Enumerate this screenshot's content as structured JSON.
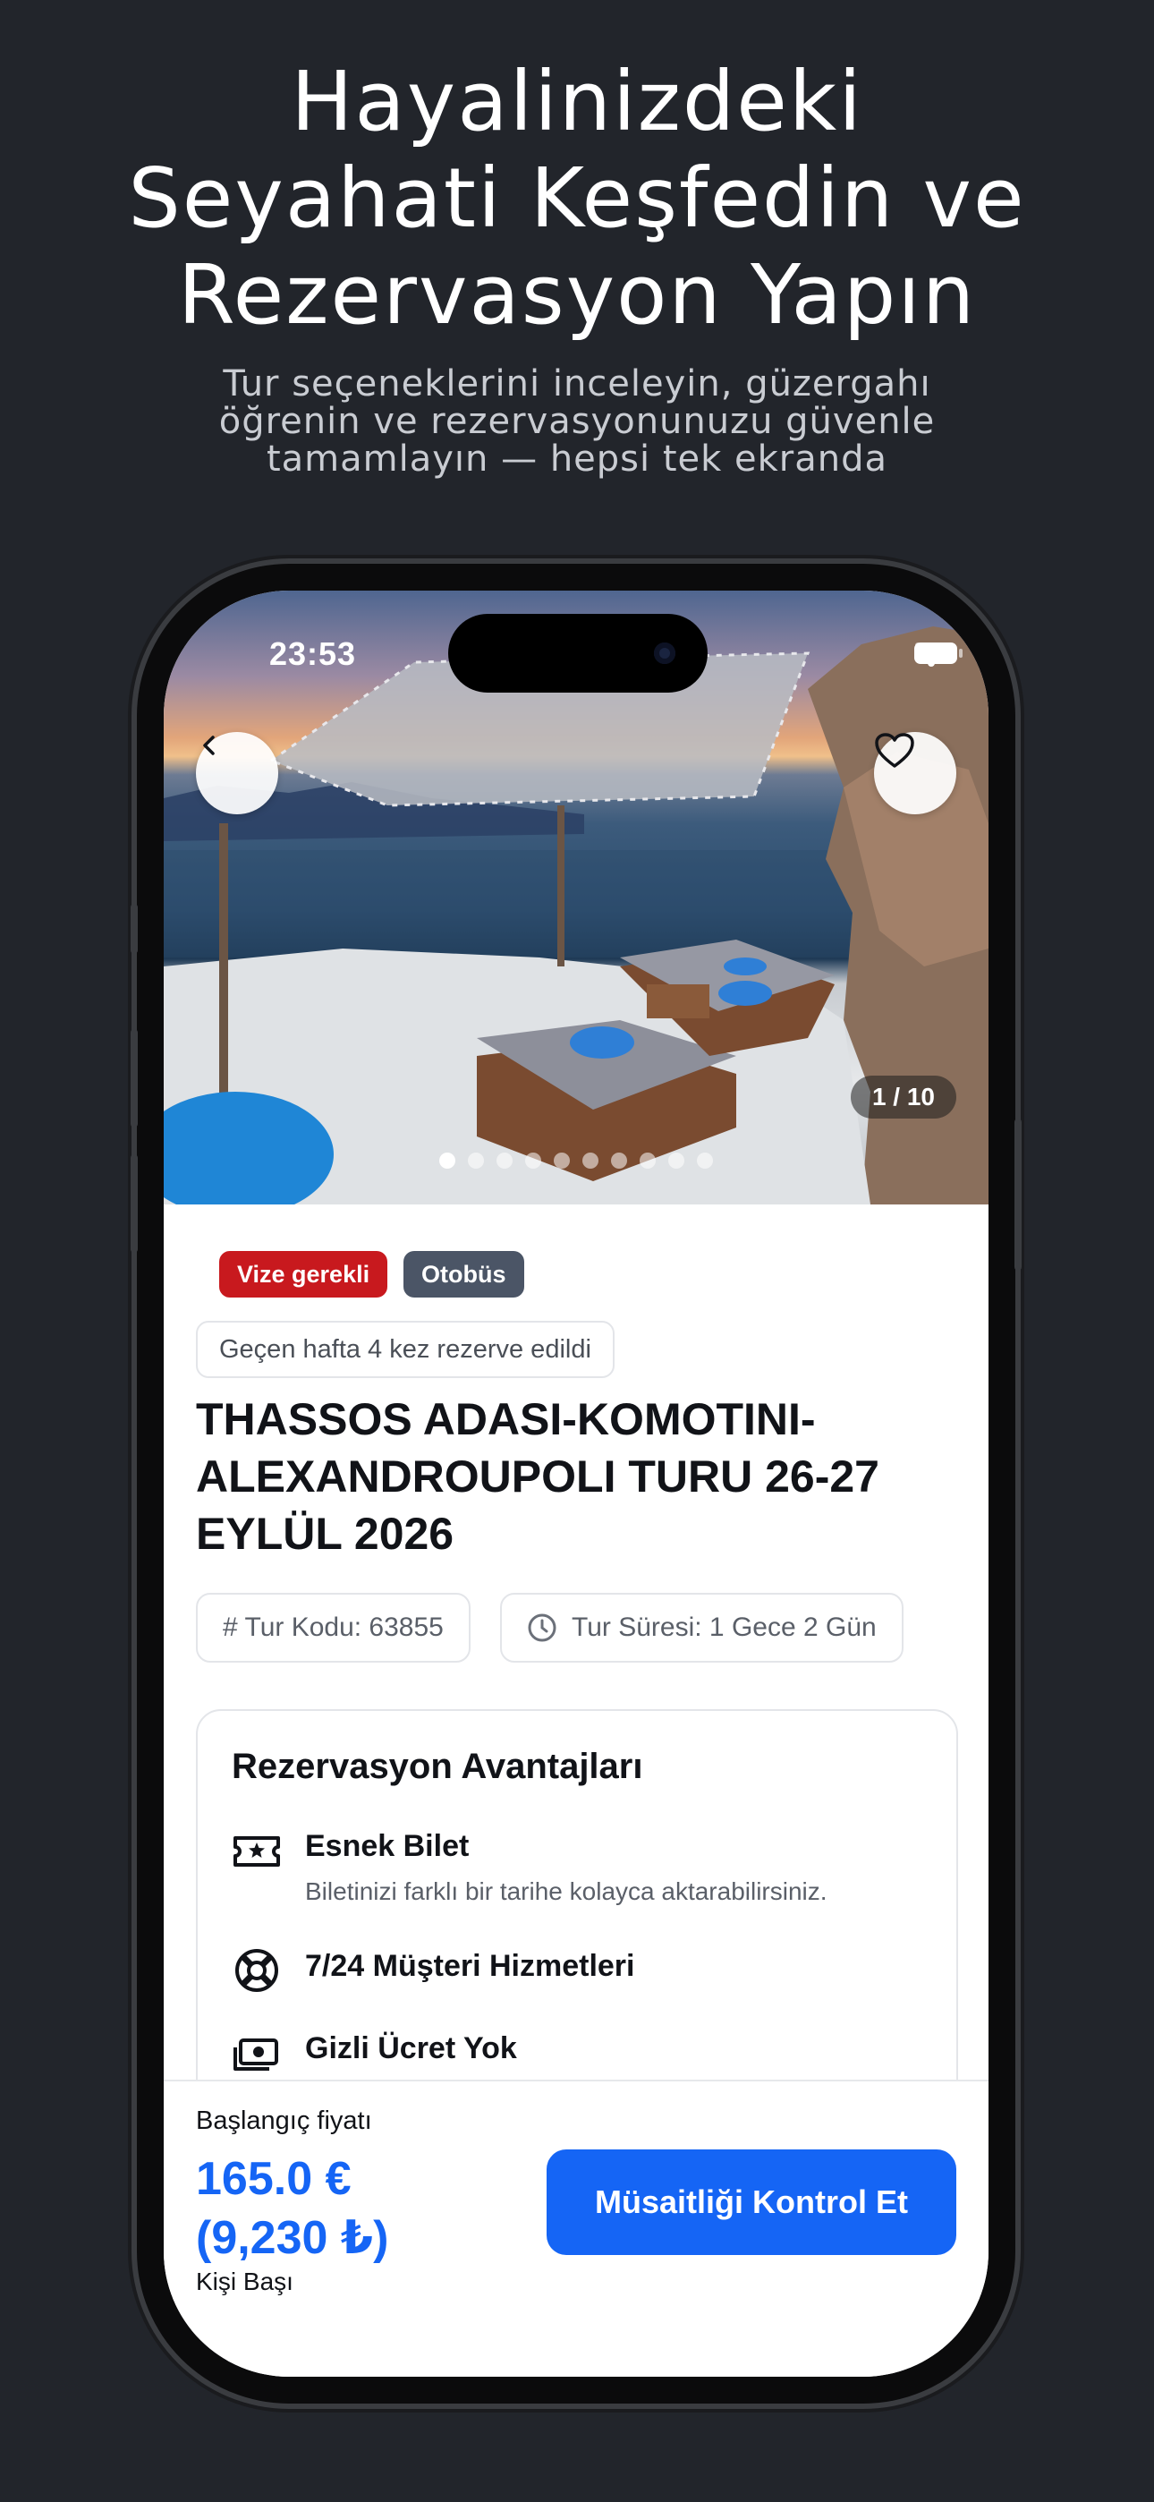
{
  "headline": {
    "line1": "Hayalinizdeki",
    "line2": "Seyahati Keşfedin ve",
    "line3": "Rezervasyon Yapın"
  },
  "subtitle": {
    "line1": "Tur seçeneklerini inceleyin, güzergahı",
    "line2": "öğrenin ve rezervasyonunuzu güvenle",
    "line3": "tamamlayın — hepsi tek ekranda"
  },
  "status_bar": {
    "time": "23:53"
  },
  "gallery": {
    "counter": "1 / 10",
    "total_images": 10,
    "active_index": 1,
    "back_icon": "chevron-left-icon",
    "favorite_icon": "heart-outline-icon"
  },
  "tags": [
    {
      "label": "Vize gerekli",
      "color": "#c8191e"
    },
    {
      "label": "Otobüs",
      "color": "#4b5566"
    }
  ],
  "popularity": "Geçen hafta 4 kez rezerve edildi",
  "tour": {
    "title": "THASSOS ADASI-KOMOTINI-ALEXANDROUPOLI TURU 26-27 EYLÜL 2026",
    "code": "# Tur Kodu: 63855",
    "duration": "Tur Süresi: 1 Gece 2 Gün"
  },
  "advantages": {
    "title": "Rezervasyon Avantajları",
    "items": [
      {
        "icon": "ticket-star-icon",
        "title": "Esnek Bilet",
        "desc": "Biletinizi farklı bir tarihe kolayca aktarabilirsiniz."
      },
      {
        "icon": "lifebuoy-icon",
        "title": "7/24 Müşteri Hizmetleri",
        "desc": ""
      },
      {
        "icon": "money-icon",
        "title": "Gizli Ücret Yok",
        "desc": ""
      }
    ]
  },
  "booking": {
    "price_label": "Başlangıç fiyatı",
    "price_eur": "165.0 €",
    "price_try": "(9,230 ₺)",
    "per_person": "Kişi Başı",
    "cta": "Müsaitliği Kontrol Et"
  },
  "colors": {
    "accent": "#1565f5",
    "background": "#22252b"
  }
}
